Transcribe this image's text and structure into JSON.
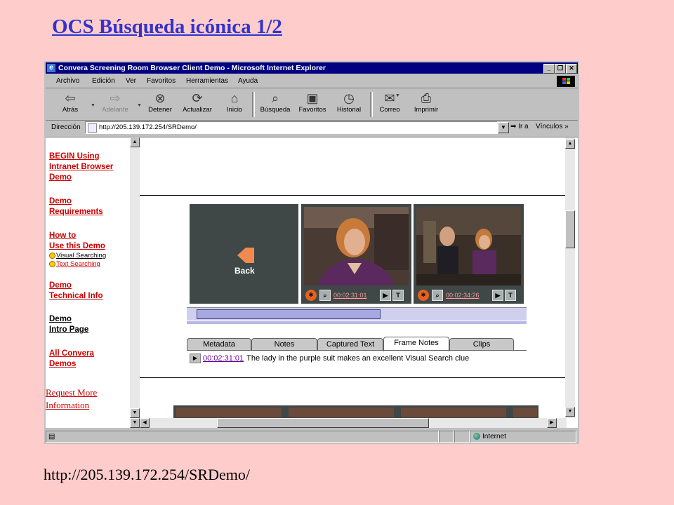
{
  "slide": {
    "title": "OCS Búsqueda icónica 1/2",
    "url": "http://205.139.172.254/SRDemo/"
  },
  "window": {
    "title": "Convera Screening Room Browser Client Demo - Microsoft Internet Explorer",
    "minimize": "_",
    "maximize": "❐",
    "close": "✕"
  },
  "menu": [
    "Archivo",
    "Edición",
    "Ver",
    "Favoritos",
    "Herramientas",
    "Ayuda"
  ],
  "toolbar": {
    "back": "Atrás",
    "forward": "Adelante",
    "stop": "Detener",
    "refresh": "Actualizar",
    "home": "Inicio",
    "search": "Búsqueda",
    "favorites": "Favoritos",
    "history": "Historial",
    "mail": "Correo",
    "print": "Imprimir"
  },
  "address": {
    "label": "Dirección",
    "value": "http://205.139.172.254/SRDemo/",
    "go": "Ir a",
    "links": "Vínculos »"
  },
  "nav": {
    "begin": [
      "BEGIN Using",
      "Intranet Browser",
      "Demo"
    ],
    "requirements": [
      "Demo",
      "Requirements"
    ],
    "howto": [
      "How to",
      "Use this Demo"
    ],
    "visual_searching": "Visual Searching",
    "text_searching": "Text Searching",
    "technical": [
      "Demo",
      "Technical Info"
    ],
    "intro": [
      "Demo",
      "Intro Page"
    ],
    "all_demos": [
      "All Convera",
      "Demos"
    ],
    "request": [
      "Request More",
      "Information"
    ]
  },
  "player": {
    "back_label": "Back",
    "frames": [
      {
        "time": "00:02:31:01"
      },
      {
        "time": "00:02:34:26"
      }
    ],
    "tabs": [
      "Metadata",
      "Notes",
      "Captured Text",
      "Frame Notes",
      "Clips"
    ],
    "active_tab": "Frame Notes",
    "note": {
      "time": "00:02:31:01",
      "text": "The lady in the purple suit makes an excellent Visual Search clue"
    }
  },
  "status": {
    "zone": "Internet"
  }
}
